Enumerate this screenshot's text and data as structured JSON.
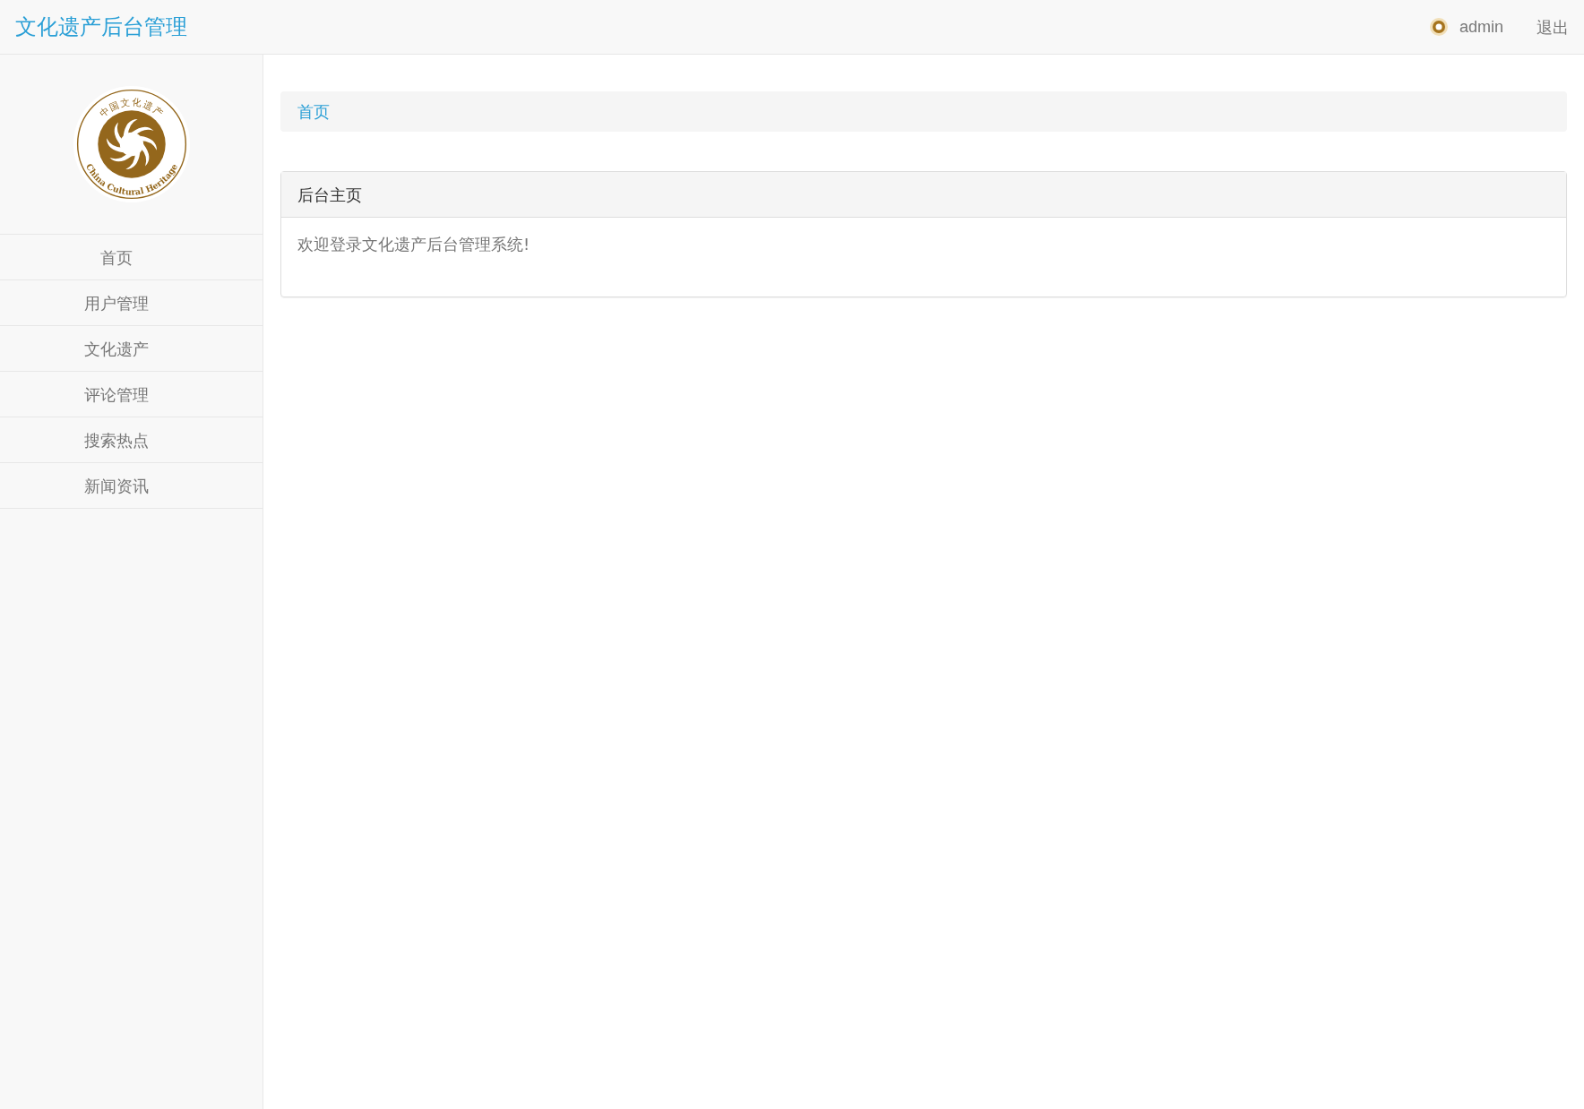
{
  "header": {
    "title": "文化遗产后台管理",
    "user": "admin",
    "logout": "退出"
  },
  "logo": {
    "top_text": "中国文化遗产",
    "bottom_text": "China Cultural Heritage"
  },
  "nav": [
    {
      "label": "首页",
      "selected": false
    },
    {
      "label": "用户管理",
      "selected": false
    },
    {
      "label": "文化遗产",
      "selected": false
    },
    {
      "label": "评论管理",
      "selected": false
    },
    {
      "label": "搜索热点",
      "selected": false
    },
    {
      "label": "新闻资讯",
      "selected": false
    }
  ],
  "breadcrumb": [
    "首页"
  ],
  "panel": {
    "title": "后台主页",
    "body": "欢迎登录文化遗产后台管理系统!"
  }
}
